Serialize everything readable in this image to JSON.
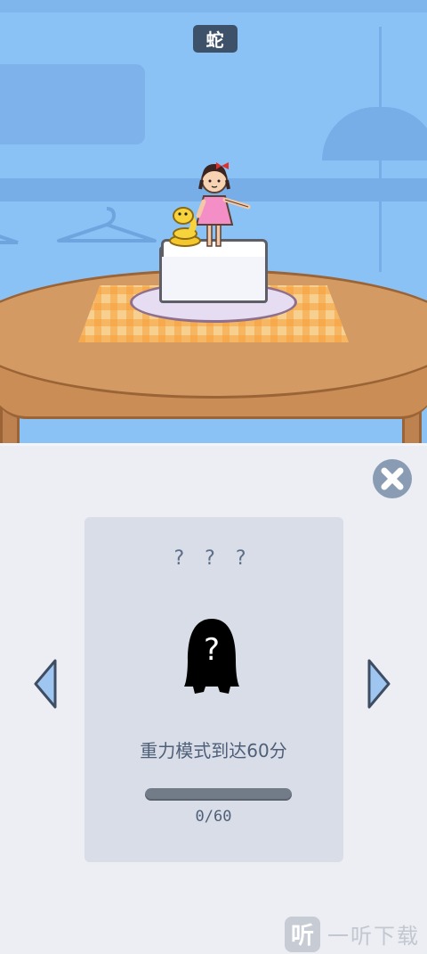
{
  "scene": {
    "title": "蛇"
  },
  "card": {
    "name": "? ? ?",
    "condition": "重力模式到达60分",
    "progress_fraction": 0,
    "progress_text": "0/60"
  },
  "nav": {
    "prev_icon": "left-triangle-arrow",
    "next_icon": "right-triangle-arrow",
    "close_icon": "close-x-circle"
  },
  "watermark": {
    "logo_text": "听",
    "text": "一听下载"
  },
  "colors": {
    "sky": "#8bc2f6",
    "panel": "#eceef4",
    "card": "#d9dde8",
    "title_badge": "#3d5169",
    "text": "#4e5f78",
    "arrow": "#9fc6f0"
  }
}
